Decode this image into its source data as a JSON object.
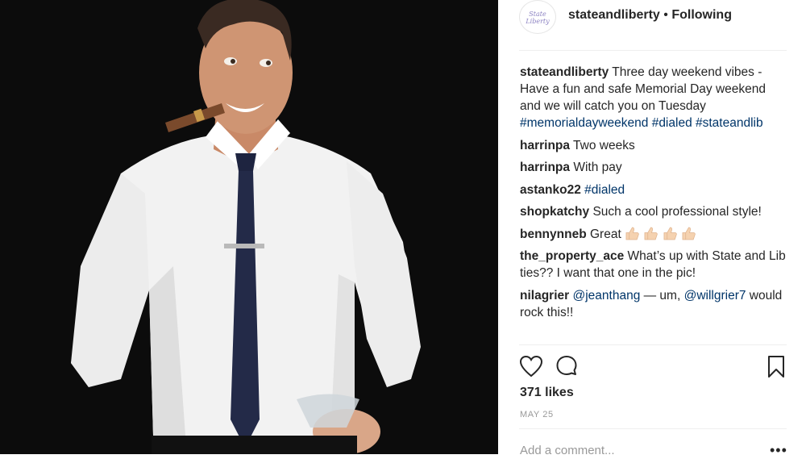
{
  "post": {
    "username": "stateandliberty",
    "avatar_text": "State Liberty",
    "separator": "•",
    "follow_status": "Following",
    "image_description_icon": "photo-icon"
  },
  "caption": {
    "username": "stateandliberty",
    "text": "Three day weekend vibes - Have a fun and safe Memorial Day weekend and we will catch you on Tuesday",
    "hashtags": "#memorialdayweekend #dialed #stateandlib"
  },
  "comments": [
    {
      "username": "harrinpa",
      "text": "Two weeks"
    },
    {
      "username": "harrinpa",
      "text": "With pay"
    },
    {
      "username": "astanko22",
      "text": "",
      "tag": "#dialed"
    },
    {
      "username": "shopkatchy",
      "text": "Such a cool professional style!"
    },
    {
      "username": "bennynneb",
      "text": "Great"
    },
    {
      "username": "the_property_ace",
      "text": "What’s up with State and Lib ties?? I want that one in the pic!"
    },
    {
      "username": "nilagrier",
      "mention1": "@jeanthang",
      "middle": "— um,",
      "mention2": "@willgrier7",
      "tail": "would rock this!!"
    }
  ],
  "actions": {
    "like_icon": "heart-icon",
    "comment_icon": "comment-icon",
    "save_icon": "bookmark-icon"
  },
  "likes": "371 likes",
  "date": "MAY 25",
  "add_comment": {
    "placeholder": "Add a comment...",
    "more": "•••"
  },
  "colors": {
    "link": "#003569",
    "text": "#262626",
    "muted": "#999999",
    "divider": "#efefef"
  }
}
